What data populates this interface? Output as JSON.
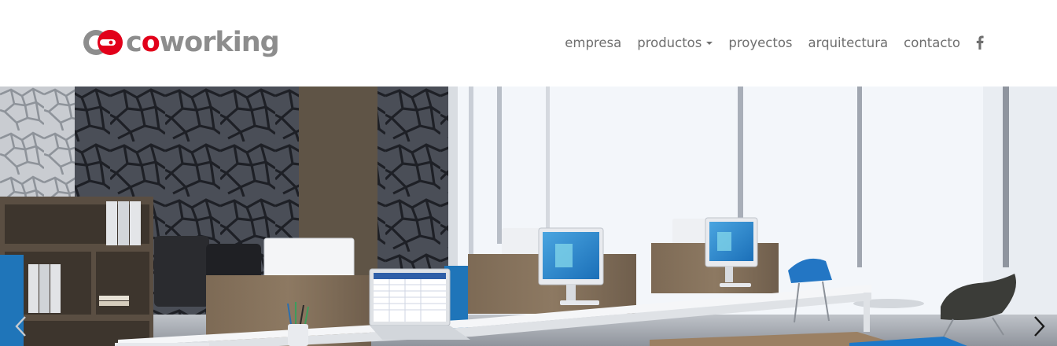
{
  "brand": {
    "logo_text_1": "c",
    "logo_text_accent": "o",
    "logo_text_2": "working",
    "primary_color": "#e2001a",
    "text_color": "#8d8d8d"
  },
  "nav": {
    "items": [
      {
        "label": "empresa"
      },
      {
        "label": "productos",
        "has_dropdown": true
      },
      {
        "label": "proyectos"
      },
      {
        "label": "arquitectura"
      },
      {
        "label": "contacto"
      }
    ],
    "social_icon": "facebook-icon"
  },
  "hero": {
    "description_icon_prev": "chevron-left-icon",
    "description_icon_next": "chevron-right-icon"
  }
}
